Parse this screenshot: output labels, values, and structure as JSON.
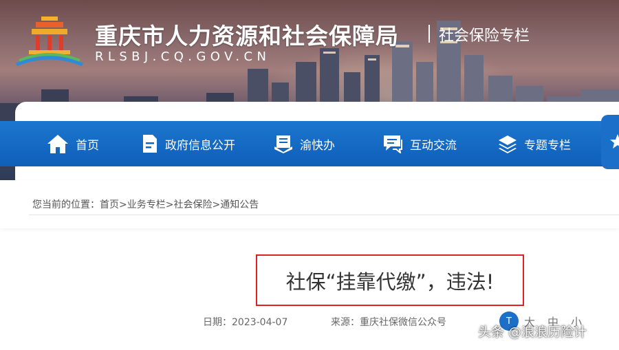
{
  "header": {
    "title": "重庆市人力资源和社会保障局",
    "subtitle": "社会保险专栏",
    "url": "RLSBJ.CQ.GOV.CN"
  },
  "nav": {
    "items": [
      {
        "label": "首页",
        "icon": "home-icon"
      },
      {
        "label": "政府信息公开",
        "icon": "document-icon"
      },
      {
        "label": "渝快办",
        "icon": "book-icon"
      },
      {
        "label": "互动交流",
        "icon": "chat-icon"
      },
      {
        "label": "专题专栏",
        "icon": "layers-icon"
      }
    ],
    "right_icon": "star-icon"
  },
  "breadcrumb": {
    "prefix": "您当前的位置：",
    "path": "首页>业务专栏>社会保险>通知公告"
  },
  "article": {
    "title": "社保“挂靠代缴”，违法!",
    "date_label": "日期：",
    "date": "2023-04-07",
    "source_label": "来源：",
    "source": "重庆社保微信公众号"
  },
  "font_size": {
    "icon": "font-size-icon",
    "options": [
      "大",
      "中",
      "小"
    ]
  },
  "watermark": "头条 @浪浪历险计",
  "colors": {
    "nav_blue": "#0f5fb8",
    "highlight_red": "#e02020"
  }
}
